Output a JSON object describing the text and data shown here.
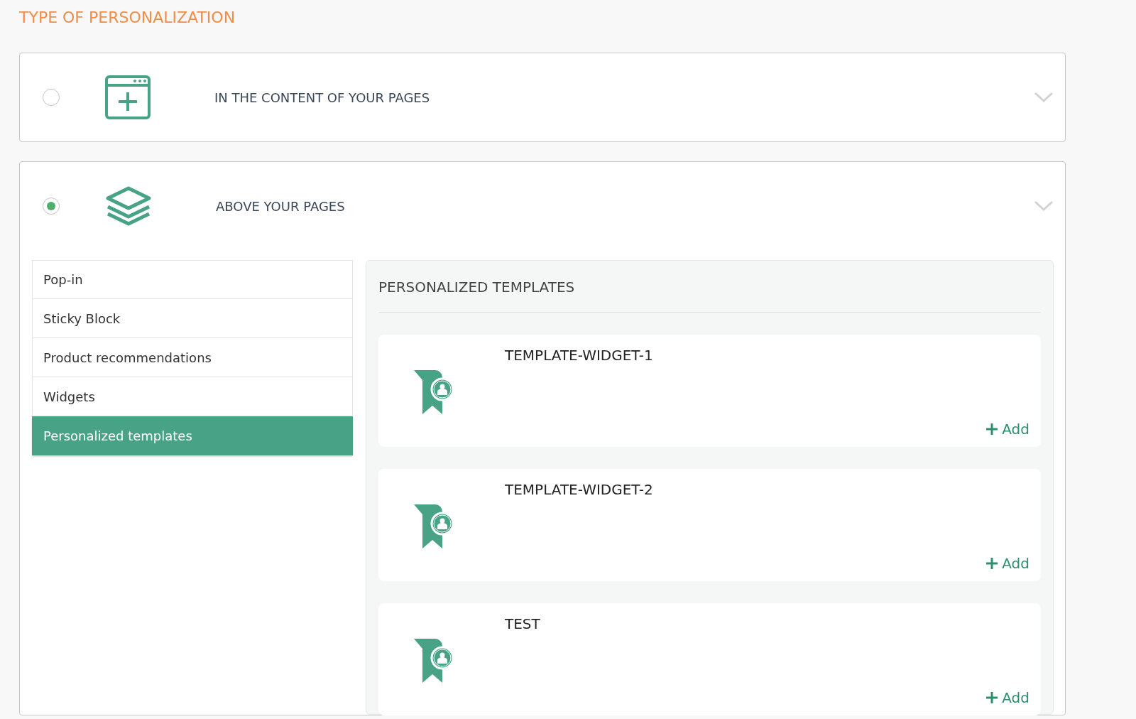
{
  "heading": "TYPE OF PERSONALIZATION",
  "options": [
    {
      "kind": "content",
      "label": "IN THE CONTENT OF YOUR PAGES",
      "selected": false
    },
    {
      "kind": "layers",
      "label": "ABOVE YOUR PAGES",
      "selected": true
    }
  ],
  "menu": [
    {
      "label": "Pop-in",
      "selected": false
    },
    {
      "label": "Sticky Block",
      "selected": false
    },
    {
      "label": "Product recommendations",
      "selected": false
    },
    {
      "label": "Widgets",
      "selected": false
    },
    {
      "label": "Personalized templates",
      "selected": true
    }
  ],
  "panel": {
    "title": "PERSONALIZED TEMPLATES",
    "templates": [
      {
        "name": "TEMPLATE-WIDGET-1",
        "action": "Add"
      },
      {
        "name": "TEMPLATE-WIDGET-2",
        "action": "Add"
      },
      {
        "name": "TEST",
        "action": "Add"
      }
    ]
  }
}
